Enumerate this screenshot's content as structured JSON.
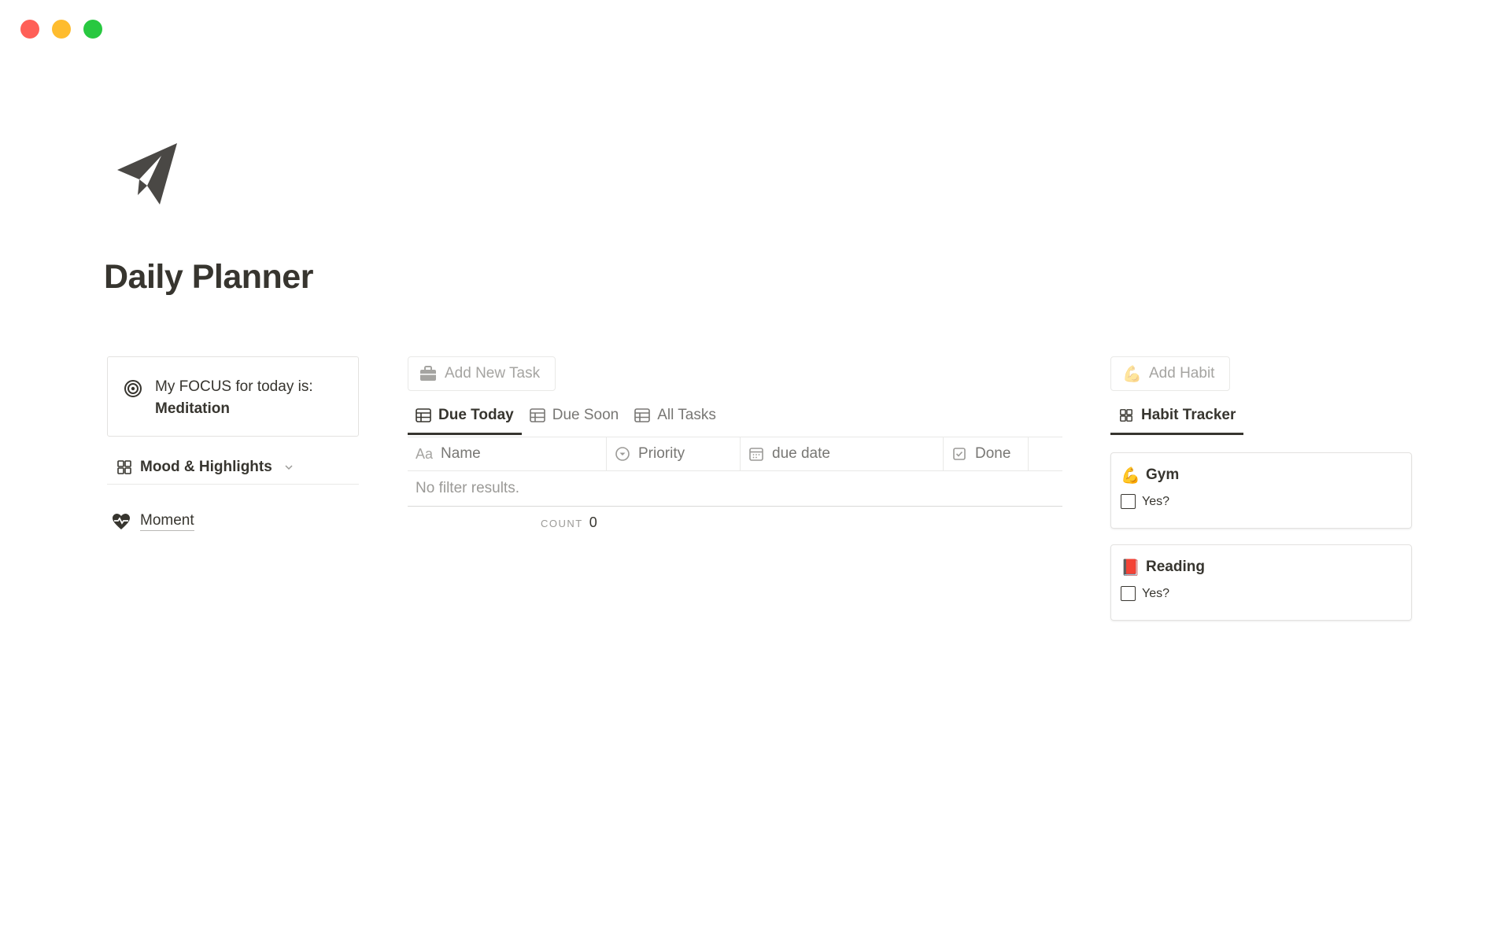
{
  "page": {
    "title": "Daily Planner",
    "icon": "paper-plane-icon"
  },
  "focus": {
    "label": "My FOCUS for today is:",
    "value": "Meditation",
    "icon": "target-icon"
  },
  "mood": {
    "label": "Mood & Highlights",
    "icon": "gallery-grid-icon"
  },
  "moment": {
    "label": "Moment",
    "icon": "heart-pulse-icon"
  },
  "tasks": {
    "add_button": "Add New Task",
    "tabs": [
      {
        "label": "Due Today",
        "active": true
      },
      {
        "label": "Due Soon",
        "active": false
      },
      {
        "label": "All Tasks",
        "active": false
      }
    ],
    "columns": {
      "name_prefix": "Aa",
      "name": "Name",
      "priority": "Priority",
      "due_date": "due date",
      "done": "Done"
    },
    "empty_text": "No filter results.",
    "count_label": "COUNT",
    "count_value": "0"
  },
  "habits": {
    "add_button": "Add Habit",
    "add_emoji": "💪",
    "tab": "Habit Tracker",
    "cards": [
      {
        "emoji": "💪",
        "title": "Gym",
        "check_label": "Yes?"
      },
      {
        "emoji": "📕",
        "title": "Reading",
        "check_label": "Yes?"
      }
    ]
  },
  "colors": {
    "text": "#37352f",
    "muted": "#787774",
    "border": "#e9e9e7",
    "traffic_red": "#ff5f57",
    "traffic_yellow": "#febc2e",
    "traffic_green": "#28c840"
  }
}
